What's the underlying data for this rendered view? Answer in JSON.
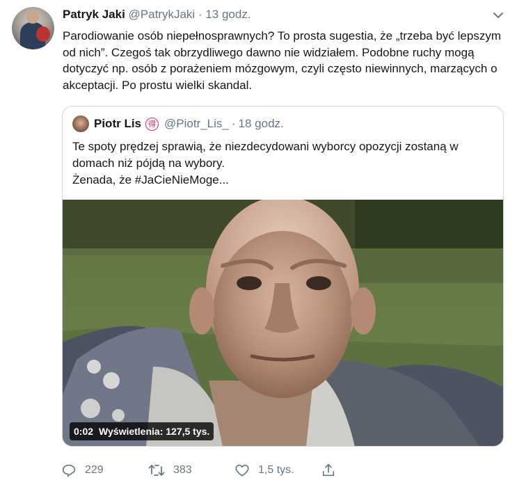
{
  "tweet": {
    "author_name": "Patryk Jaki",
    "handle": "@PatrykJaki",
    "separator": "·",
    "time": "13 godz.",
    "text": "Parodiowanie osób niepełnosprawnych? To prosta sugestia, że „trzeba być lepszym od nich”. Czegoś tak obrzydliwego dawno nie widziałem. Podobne ruchy mogą dotyczyć np. osób z porażeniem mózgowym, czyli często niewinnych, marzących o akceptacji. Po prostu wielki skandal."
  },
  "quoted": {
    "author_name": "Piotr Lis",
    "badge": "得",
    "handle": "@Piotr_Lis_",
    "separator": "·",
    "time": "18 godz.",
    "lines": [
      "Te spoty prędzej sprawią, że niezdecydowani wyborcy opozycji zostaną w domach niż pójdą na wybory.",
      "Żenada, że #JaCieNieMoge..."
    ],
    "video": {
      "duration": "0:02",
      "views": "Wyświetlenia: 127,5 tys."
    }
  },
  "actions": {
    "reply_count": "229",
    "retweet_count": "383",
    "like_count": "1,5 tys."
  },
  "icons": [
    "chevron-down-icon",
    "reply-icon",
    "retweet-icon",
    "like-icon",
    "share-icon",
    "badge-icon"
  ],
  "colors": {
    "text": "#14171a",
    "muted": "#657786",
    "border": "#ccd6dd",
    "badge": "#e0245e"
  }
}
